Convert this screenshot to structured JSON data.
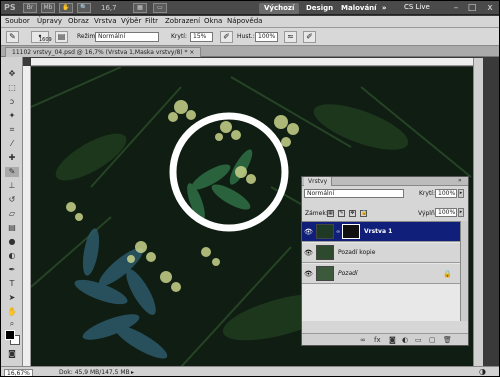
{
  "appbar": {
    "logo": "PS",
    "zoom": "16,7",
    "workspaces": [
      "Výchozí",
      "Design",
      "Malování"
    ],
    "more": "»",
    "cs_live": "CS Live",
    "win_min": "–",
    "win_max": "□",
    "win_close": "x"
  },
  "menu": [
    "Soubor",
    "Úpravy",
    "Obraz",
    "Vrstva",
    "Výběr",
    "Filtr",
    "Zobrazení",
    "Okna",
    "Nápověda"
  ],
  "options": {
    "brush_size": "1609",
    "mode_label": "Režim:",
    "mode_value": "Normální",
    "opacity_label": "Krytí:",
    "opacity_value": "15%",
    "flow_label": "Hust.:",
    "flow_value": "100%"
  },
  "document": {
    "tab_title": "11102 vrstvy_04.psd @ 16,7% (Vrstva 1,Maska vrstvy/8) *  ×"
  },
  "status": {
    "zoom": "16,67%",
    "doc_info": "Dok: 45,9 MB/147,5 MB"
  },
  "layers_panel": {
    "title": "Vrstvy",
    "close": "»",
    "blend_mode": "Normální",
    "opacity_label": "Krytí:",
    "opacity_value": "100%",
    "lock_label": "Zámek:",
    "fill_label": "Výplň:",
    "fill_value": "100%",
    "layers": [
      {
        "name": "Vrstva 1",
        "active": true,
        "has_mask": true,
        "locked": false
      },
      {
        "name": "Pozadí kopie",
        "active": false,
        "has_mask": false,
        "locked": false
      },
      {
        "name": "Pozadí",
        "active": false,
        "has_mask": false,
        "locked": true
      }
    ]
  },
  "colors": {
    "foreground": "#000000",
    "background": "#ffffff",
    "selected_layer": "#10207a"
  }
}
